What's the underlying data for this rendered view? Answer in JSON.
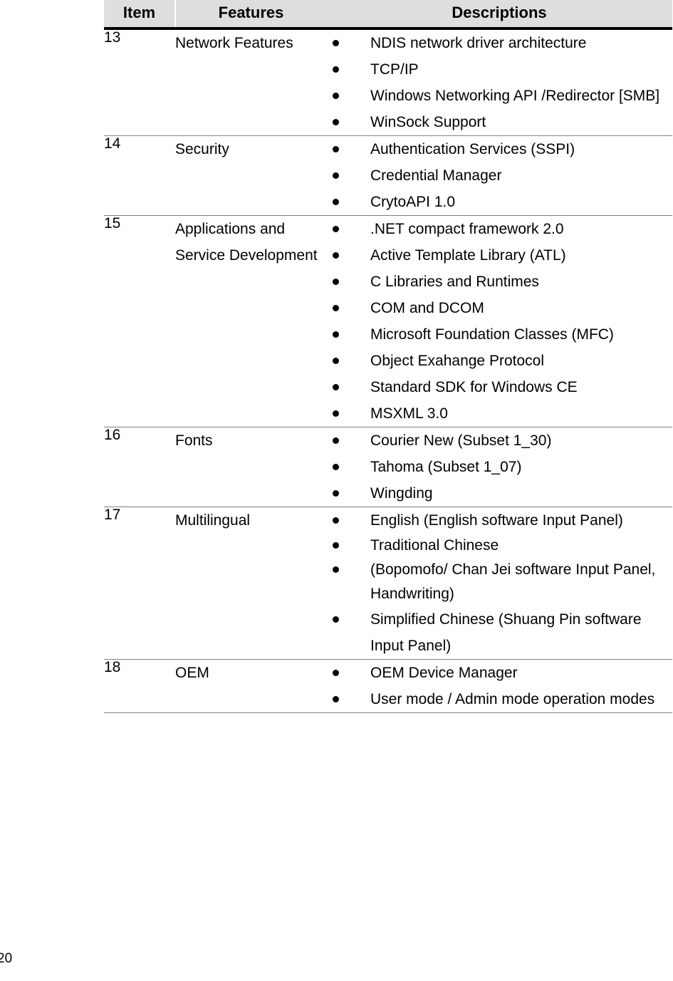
{
  "document": {
    "page_number": "20"
  },
  "table": {
    "columns": [
      {
        "key": "item",
        "label": "Item"
      },
      {
        "key": "features",
        "label": "Features"
      },
      {
        "key": "descriptions",
        "label": "Descriptions"
      }
    ],
    "rows": [
      {
        "item": "13",
        "features": "Network Features",
        "descriptions": [
          "NDIS network driver architecture",
          "TCP/IP",
          "Windows Networking API /Redirector [SMB]",
          "WinSock Support"
        ]
      },
      {
        "item": "14",
        "features": "Security",
        "descriptions": [
          "Authentication Services (SSPI)",
          "Credential Manager",
          "CrytoAPI 1.0"
        ]
      },
      {
        "item": "15",
        "features": "Applications and Service Development",
        "descriptions": [
          ".NET compact framework 2.0",
          "Active Template Library (ATL)",
          "C Libraries and Runtimes",
          "COM and DCOM",
          "Microsoft Foundation Classes (MFC)",
          "Object Exahange Protocol",
          "Standard SDK for Windows CE",
          "MSXML 3.0"
        ]
      },
      {
        "item": "16",
        "features": "Fonts",
        "descriptions": [
          "Courier New (Subset 1_30)",
          "Tahoma (Subset 1_07)",
          "Wingding"
        ]
      },
      {
        "item": "17",
        "features": "Multilingual",
        "descriptions": [
          "English (English software Input Panel)",
          "Traditional Chinese",
          "(Bopomofo/ Chan Jei software Input Panel, Handwriting)",
          "Simplified Chinese (Shuang Pin software Input Panel)"
        ]
      },
      {
        "item": "18",
        "features": "OEM",
        "descriptions": [
          "OEM Device Manager",
          "User mode / Admin mode operation modes"
        ]
      }
    ]
  }
}
